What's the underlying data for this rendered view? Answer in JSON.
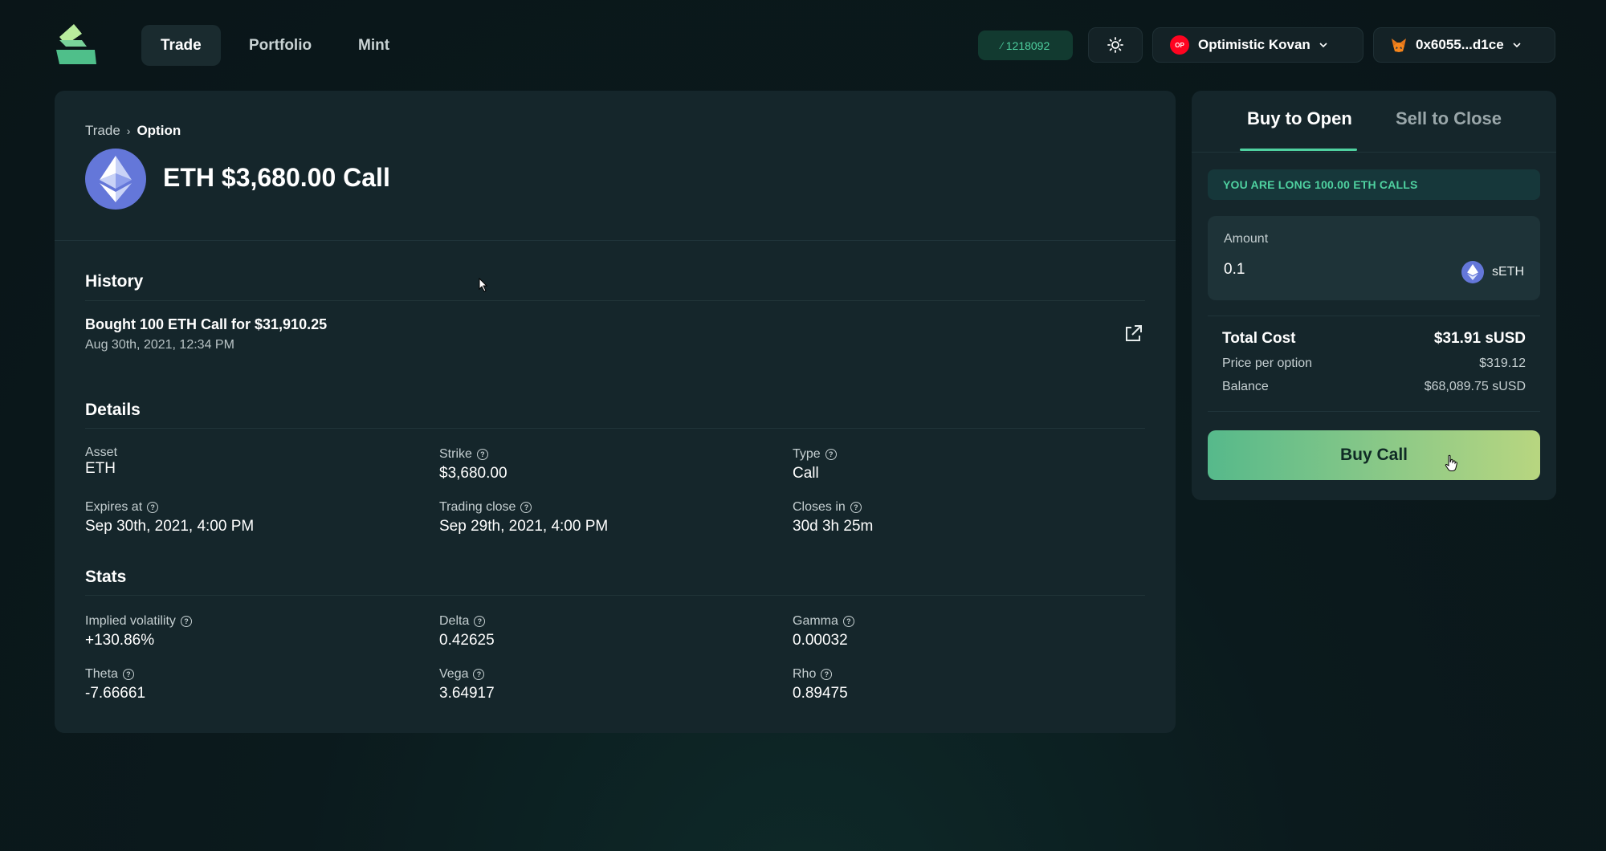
{
  "header": {
    "tabs": [
      {
        "label": "Trade",
        "active": true
      },
      {
        "label": "Portfolio",
        "active": false
      },
      {
        "label": "Mint",
        "active": false
      }
    ],
    "block_number": "1218092",
    "network": {
      "badge": "OP",
      "name": "Optimistic Kovan"
    },
    "wallet": "0x6055...d1ce"
  },
  "breadcrumb": {
    "parent": "Trade",
    "current": "Option"
  },
  "page_title": "ETH $3,680.00 Call",
  "history": {
    "title": "History",
    "items": [
      {
        "text": "Bought 100 ETH Call for $31,910.25",
        "date": "Aug 30th, 2021, 12:34 PM"
      }
    ]
  },
  "details": {
    "title": "Details",
    "asset": {
      "label": "Asset",
      "value": "ETH"
    },
    "strike": {
      "label": "Strike",
      "value": "$3,680.00"
    },
    "type": {
      "label": "Type",
      "value": "Call"
    },
    "expires": {
      "label": "Expires at",
      "value": "Sep 30th, 2021, 4:00 PM"
    },
    "trading_close": {
      "label": "Trading close",
      "value": "Sep 29th, 2021, 4:00 PM"
    },
    "closes_in": {
      "label": "Closes in",
      "value": "30d 3h 25m"
    }
  },
  "stats": {
    "title": "Stats",
    "iv": {
      "label": "Implied volatility",
      "value": "+130.86%"
    },
    "delta": {
      "label": "Delta",
      "value": "0.42625"
    },
    "gamma": {
      "label": "Gamma",
      "value": "0.00032"
    },
    "theta": {
      "label": "Theta",
      "value": "-7.66661"
    },
    "vega": {
      "label": "Vega",
      "value": "3.64917"
    },
    "rho": {
      "label": "Rho",
      "value": "0.89475"
    }
  },
  "trade_panel": {
    "tabs": [
      {
        "label": "Buy to Open",
        "active": true
      },
      {
        "label": "Sell to Close",
        "active": false
      }
    ],
    "position_banner": "YOU ARE LONG 100.00 ETH CALLS",
    "amount_label": "Amount",
    "amount_value": "0.1",
    "amount_unit": "sETH",
    "total_cost": {
      "label": "Total Cost",
      "value": "$31.91 sUSD"
    },
    "price_per_option": {
      "label": "Price per option",
      "value": "$319.12"
    },
    "balance": {
      "label": "Balance",
      "value": "$68,089.75 sUSD"
    },
    "buy_button": "Buy Call"
  },
  "colors": {
    "accent": "#4fd1a0",
    "panel": "#15262b",
    "eth": "#6477d9",
    "op_red": "#ff0420"
  }
}
